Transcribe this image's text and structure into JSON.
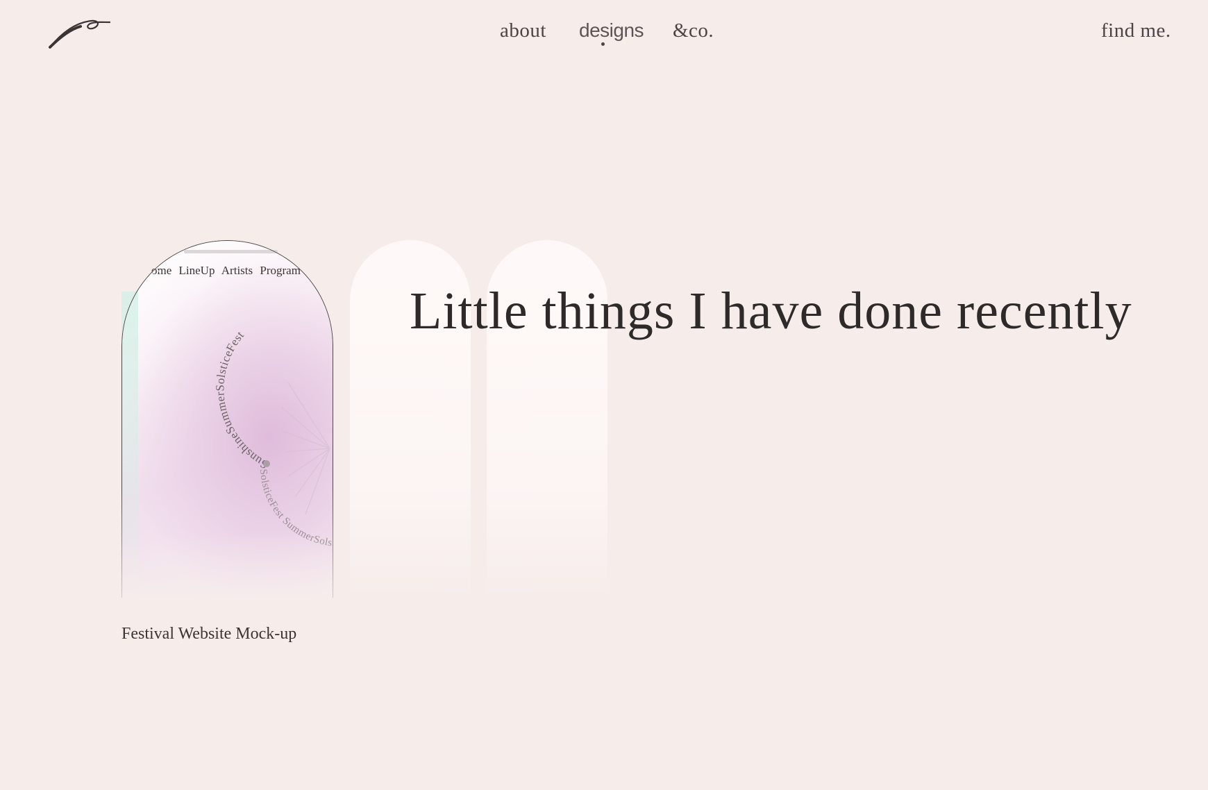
{
  "header": {
    "logo_icon": "signature-logo",
    "nav": {
      "about": "about",
      "designs": "designs",
      "co": "&co.",
      "find_me": "find me."
    },
    "active_item": "designs"
  },
  "main": {
    "headline": "Little things I have done recently",
    "projects": [
      {
        "caption": "Festival Website Mock-up",
        "mock_nav": [
          "ome",
          "LineUp",
          "Artists",
          "Program"
        ],
        "circle_text": "SunshineSummerSolsticeFest",
        "circle_text_lower": "SolsticeFest SummerSolst"
      }
    ]
  },
  "colors": {
    "background": "#f6edeb",
    "text": "#2f2a2a",
    "arch_pink": "#e6c8e0",
    "ghost_arch": "#fdf6f5"
  }
}
